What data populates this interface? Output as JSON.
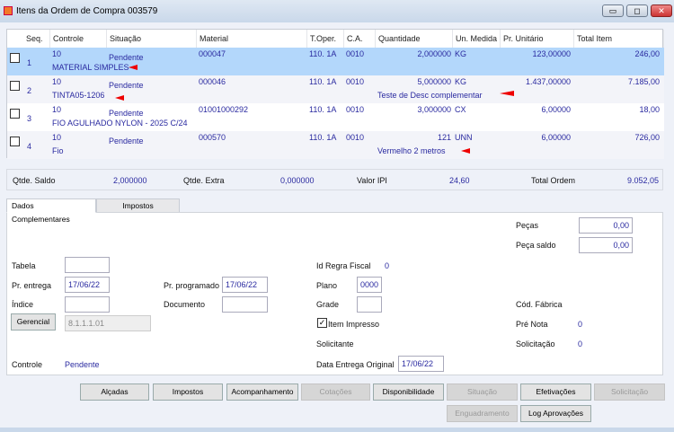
{
  "window": {
    "title": "Itens da Ordem de Compra 003579",
    "minimize": "▭",
    "maximize": "◻",
    "close": "✕"
  },
  "grid": {
    "columns": [
      "Seq.",
      "Controle",
      "Situação",
      "Material",
      "T.Oper.",
      "C.A.",
      "Quantidade",
      "Un. Medida",
      "Pr. Unitário",
      "Total Item"
    ],
    "rows": [
      {
        "seq": "1",
        "controle": "10",
        "situacao": "Pendente",
        "material": "000047",
        "toper": "110. 1A",
        "ca": "0010",
        "quantidade": "2,000000",
        "un": "KG",
        "preco": "123,00000",
        "total": "246,00",
        "descricao": "MATERIAL SIMPLES",
        "complemento": "",
        "selected": true
      },
      {
        "seq": "2",
        "controle": "10",
        "situacao": "Pendente",
        "material": "000046",
        "toper": "110. 1A",
        "ca": "0010",
        "quantidade": "5,000000",
        "un": "KG",
        "preco": "1.437,00000",
        "total": "7.185,00",
        "descricao": "TINTA05-1206",
        "complemento": "Teste de Desc complementar",
        "selected": false
      },
      {
        "seq": "3",
        "controle": "10",
        "situacao": "Pendente",
        "material": "01001000292",
        "toper": "110. 1A",
        "ca": "0010",
        "quantidade": "3,000000",
        "un": "CX",
        "preco": "6,00000",
        "total": "18,00",
        "descricao": "FIO AGULHADO NYLON - 2025 C/24",
        "complemento": "",
        "selected": false
      },
      {
        "seq": "4",
        "controle": "10",
        "situacao": "Pendente",
        "material": "000570",
        "toper": "110. 1A",
        "ca": "0010",
        "quantidade": "121",
        "un": "UNN",
        "preco": "6,00000",
        "total": "726,00",
        "descricao": "Fio",
        "complemento": "Vermelho 2 metros",
        "selected": false
      }
    ]
  },
  "summary": {
    "qtde_saldo_label": "Qtde. Saldo",
    "qtde_saldo": "2,000000",
    "qtde_extra_label": "Qtde. Extra",
    "qtde_extra": "0,000000",
    "valor_ipi_label": "Valor IPI",
    "valor_ipi": "24,60",
    "total_ordem_label": "Total Ordem",
    "total_ordem": "9.052,05"
  },
  "tabs": [
    "Dados Complementares",
    "Impostos"
  ],
  "form": {
    "pecas_label": "Peças",
    "pecas": "0,00",
    "peca_saldo_label": "Peça saldo",
    "peca_saldo": "0,00",
    "tabela_label": "Tabela",
    "tabela": "",
    "pr_entrega_label": "Pr. entrega",
    "pr_entrega": "17/06/22",
    "pr_programado_label": "Pr. programado",
    "pr_programado": "17/06/22",
    "indice_label": "Índice",
    "indice": "",
    "documento_label": "Documento",
    "documento": "",
    "gerencial_label": "Gerencial",
    "gerencial": "8.1.1.1.01",
    "controle_label": "Controle",
    "controle": "Pendente",
    "id_regra_label": "Id Regra Fiscal",
    "id_regra": "0",
    "plano_label": "Plano",
    "plano": "0000",
    "grade_label": "Grade",
    "grade": "",
    "item_impresso_label": "Item Impresso",
    "item_impresso": true,
    "solicitante_label": "Solicitante",
    "data_entrega_label": "Data Entrega Original",
    "data_entrega": "17/06/22",
    "cod_fabrica_label": "Cód. Fábrica",
    "pre_nota_label": "Pré Nota",
    "pre_nota": "0",
    "solicitacao_label": "Solicitação",
    "solicitacao": "0"
  },
  "buttons": {
    "alcadas": "Alçadas",
    "impostos": "Impostos",
    "acompanhamento": "Acompanhamento",
    "cotacoes": "Cotações",
    "disponibilidade": "Disponibilidade",
    "situacao": "Situação",
    "efetivacoes": "Efetivações",
    "solicitacao": "Solicitação",
    "enguadramento": "Enguadramento",
    "log_aprovacoes": "Log Aprovações"
  },
  "colors": {
    "selected_row": "#b3d7fb",
    "value_text": "#2a2aa0",
    "annotation_arrow": "#e00000"
  }
}
